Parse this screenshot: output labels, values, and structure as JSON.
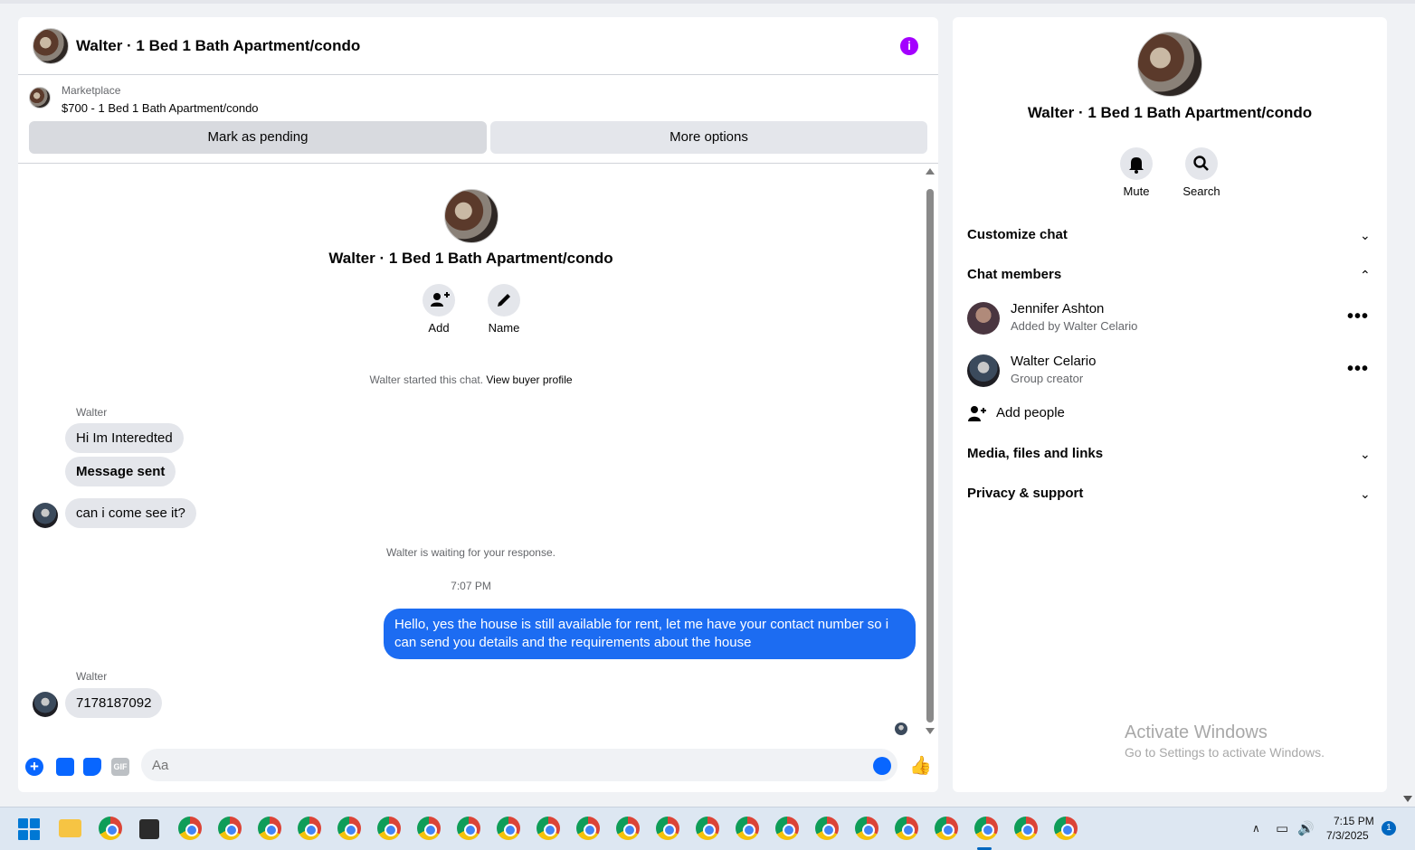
{
  "chat": {
    "header_title": "Walter · 1 Bed 1 Bath Apartment/condo",
    "info_glyph": "i",
    "marketplace_label": "Marketplace",
    "listing": "$700 - 1 Bed 1 Bath Apartment/condo",
    "btn_pending": "Mark as pending",
    "btn_more": "More options",
    "intro_title": "Walter · 1 Bed 1 Bath Apartment/condo",
    "intro_add": "Add",
    "intro_name": "Name",
    "started_text": "Walter started this chat.",
    "view_profile": "View buyer profile",
    "sender_1": "Walter",
    "msg_1": "Hi Im Interedted",
    "msg_2": "Message sent",
    "msg_3": "can i come see it?",
    "waiting": "Walter is waiting for your response.",
    "time": "7:07 PM",
    "reply": "Hello, yes the house is still available for rent, let me have your contact number so i can send you details and the requirements about the house",
    "sender_2": "Walter",
    "msg_4": "7178187092",
    "input_value": "",
    "input_placeholder": "Aa",
    "gif_label": "GIF"
  },
  "side": {
    "title": "Walter · 1 Bed 1 Bath Apartment/condo",
    "mute_label": "Mute",
    "search_label": "Search",
    "customize": "Customize chat",
    "members_header": "Chat members",
    "members": [
      {
        "name": "Jennifer Ashton",
        "sub": "Added by Walter Celario"
      },
      {
        "name": "Walter Celario",
        "sub": "Group creator"
      }
    ],
    "add_people": "Add people",
    "media": "Media, files and links",
    "privacy": "Privacy & support"
  },
  "watermark": {
    "line1": "Activate Windows",
    "line2": "Go to Settings to activate Windows."
  },
  "taskbar": {
    "time": "7:15 PM",
    "date": "7/3/2025",
    "notifications": "1"
  },
  "colors": {
    "accent": "#0866ff",
    "outgoing_bubble": "#1c6cf2",
    "info": "#a400ff"
  }
}
